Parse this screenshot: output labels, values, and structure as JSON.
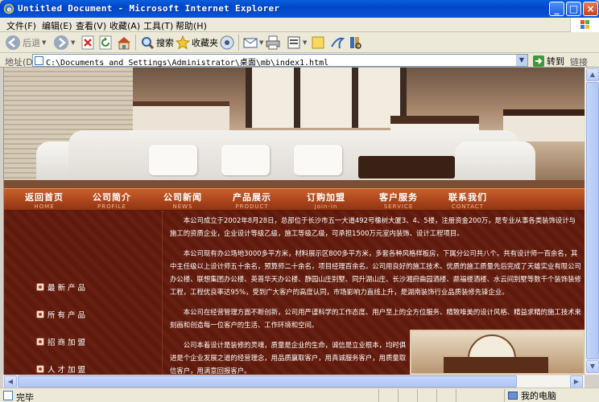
{
  "window": {
    "title": "Untitled Document - Microsoft Internet Explorer",
    "controls": {
      "minimize": "_",
      "maximize": "□",
      "close": "×"
    }
  },
  "menu": [
    "文件(F)",
    "编辑(E)",
    "查看(V)",
    "收藏(A)",
    "工具(T)",
    "帮助(H)"
  ],
  "toolbar": {
    "back": "后退",
    "search": "搜索",
    "favorites": "收藏夹"
  },
  "address": {
    "label": "地址(D)",
    "url": "C:\\Documents and Settings\\Administrator\\桌面\\mb\\index1.html",
    "go": "转到",
    "links": "链接"
  },
  "nav": [
    {
      "zh": "返回首页",
      "en": "HOME"
    },
    {
      "zh": "公司简介",
      "en": "PROFILE"
    },
    {
      "zh": "公司新闻",
      "en": "NEWS"
    },
    {
      "zh": "产品展示",
      "en": "PRODUCT"
    },
    {
      "zh": "订购加盟",
      "en": "Join-in"
    },
    {
      "zh": "客户服务",
      "en": "SERVICE"
    },
    {
      "zh": "联系我们",
      "en": "CONTACT"
    }
  ],
  "sidebar": [
    "最新产品",
    "所有产品",
    "招商加盟",
    "人才加盟"
  ],
  "content": {
    "paragraphs": [
      "本公司成立于2002年8月28日，总部位于长沙市五一大道492号橡树大厦3、4、5楼，注册资金200万，是专业从事各类装饰设计与施工的资质企业，企业设计等级乙级，施工等级乙级，可承担1500万元室内装饰、设计工程项目。",
      "本公司现有办公场地3000多平方米，材料展示区800多平方米，多套各种风格样板房，下属分公司共八个。共有设计师一百余名，其中主任级以上设计师五十余名，预算师二十余名，项目经理百余名。公司用良好的施工技术、优质的施工质量先后完成了天雄实业有限公司办公楼、联想集团办公楼、英普华天办公楼、静园山庄别墅、同升湖山庄、长沙湘府曲园酒楼、鼎福楼酒楼、水云间别墅等数千个装饰装修工程，工程优良率达95%，受到广大客户的高度认同，市场影响力直线上升，是湖南装饰行业品质装修先锋企业。",
      "本公司在经营管理方面不断创新，公司用严谨科学的工作态度、用户至上的全方位服务、精致唯美的设计风格、精益求精的施工技术来刻画和创造每一位客户的生活、工作环境和空间。",
      "公司本着设计是装修的灵魂，质量是企业的生命，诚信是立业根本，均时俱进是个企业发展之道的经营理念，用品质赢取客户，用真诚服务客户，用质量取信客户，用满意回报客户。"
    ]
  },
  "status": {
    "text": "完毕",
    "zone": "我的电脑"
  }
}
